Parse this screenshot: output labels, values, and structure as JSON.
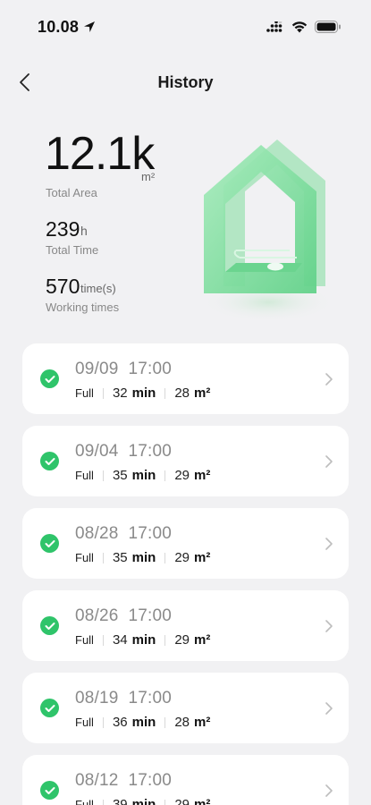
{
  "status_bar": {
    "time": "10.08",
    "icons": [
      "location-arrow-icon",
      "cellular-signal-icon",
      "wifi-icon",
      "battery-icon"
    ]
  },
  "header": {
    "title": "History",
    "back_icon": "chevron-left-icon"
  },
  "stats": {
    "area": {
      "value": "12.1k",
      "unit": "m²",
      "label": "Total Area"
    },
    "time": {
      "value": "239",
      "unit": "h",
      "label": "Total Time"
    },
    "working": {
      "value": "570",
      "unit": "time(s)",
      "label": "Working times"
    }
  },
  "illustration": {
    "icon": "house-robot-illustration",
    "color": "#8fe0a6"
  },
  "history": [
    {
      "date": "09/09",
      "time": "17:00",
      "mode": "Full",
      "duration": "32",
      "duration_unit": "min",
      "area": "28",
      "area_unit": "m²"
    },
    {
      "date": "09/04",
      "time": "17:00",
      "mode": "Full",
      "duration": "35",
      "duration_unit": "min",
      "area": "29",
      "area_unit": "m²"
    },
    {
      "date": "08/28",
      "time": "17:00",
      "mode": "Full",
      "duration": "35",
      "duration_unit": "min",
      "area": "29",
      "area_unit": "m²"
    },
    {
      "date": "08/26",
      "time": "17:00",
      "mode": "Full",
      "duration": "34",
      "duration_unit": "min",
      "area": "29",
      "area_unit": "m²"
    },
    {
      "date": "08/19",
      "time": "17:00",
      "mode": "Full",
      "duration": "36",
      "duration_unit": "min",
      "area": "28",
      "area_unit": "m²"
    },
    {
      "date": "08/12",
      "time": "17:00",
      "mode": "Full",
      "duration": "39",
      "duration_unit": "min",
      "area": "29",
      "area_unit": "m²"
    }
  ],
  "colors": {
    "success": "#2fc46a",
    "background": "#f1f1f3",
    "card": "#ffffff",
    "muted_text": "#8a8a8a"
  }
}
